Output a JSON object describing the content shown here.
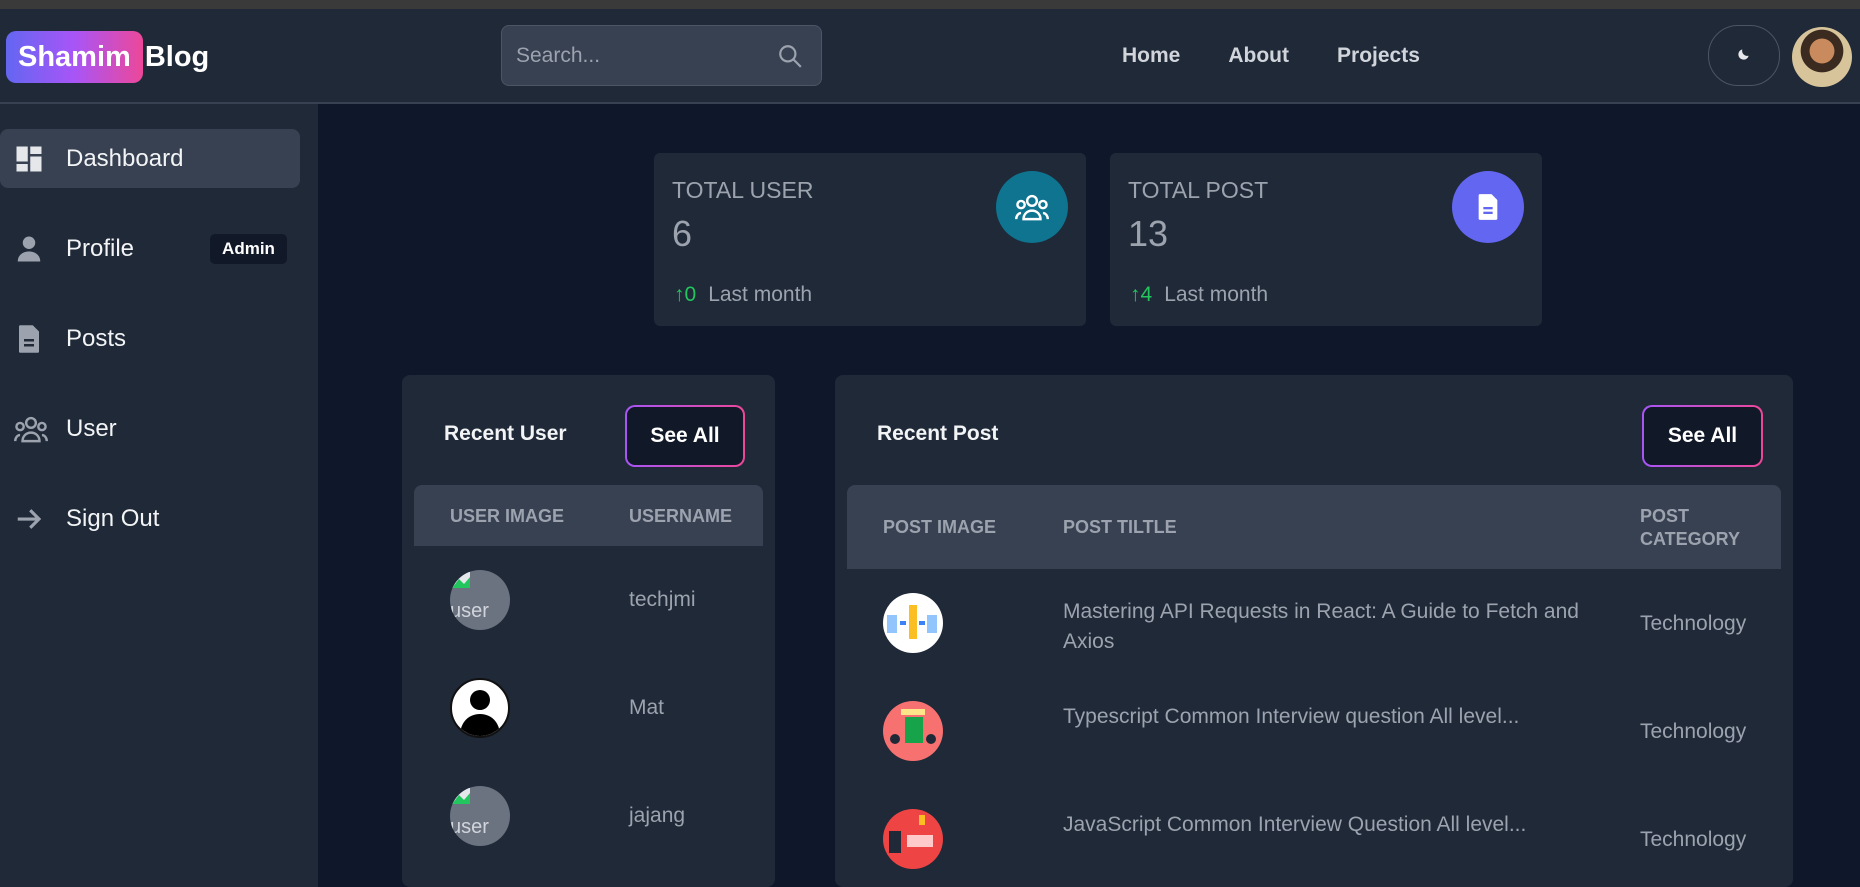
{
  "brand": {
    "pill": "Shamim",
    "text": "Blog"
  },
  "search": {
    "placeholder": "Search..."
  },
  "nav": {
    "home": "Home",
    "about": "About",
    "projects": "Projects"
  },
  "sidebar": {
    "items": [
      {
        "label": "Dashboard",
        "icon": "dashboard-icon",
        "active": true
      },
      {
        "label": "Profile",
        "icon": "user-icon",
        "badge": "Admin"
      },
      {
        "label": "Posts",
        "icon": "document-icon"
      },
      {
        "label": "User",
        "icon": "users-icon"
      },
      {
        "label": "Sign Out",
        "icon": "arrow-right-icon"
      }
    ]
  },
  "stats": {
    "users": {
      "title": "TOTAL USER",
      "value": "6",
      "change": "0",
      "period": "Last month",
      "color": "#0e7490"
    },
    "posts": {
      "title": "TOTAL POST",
      "value": "13",
      "change": "4",
      "period": "Last month",
      "color": "#6366f1"
    }
  },
  "recent_users": {
    "title": "Recent User",
    "see_all": "See All",
    "columns": [
      "USER IMAGE",
      "USERNAME"
    ],
    "rows": [
      {
        "username": "techjmi",
        "image_alt": "user"
      },
      {
        "username": "Mat",
        "image_alt": ""
      },
      {
        "username": "jajang",
        "image_alt": "user"
      }
    ]
  },
  "recent_posts": {
    "title": "Recent Post",
    "see_all": "See All",
    "columns": [
      "POST IMAGE",
      "POST TILTLE",
      "POST CATEGORY"
    ],
    "rows": [
      {
        "title": "Mastering API Requests in React: A Guide to Fetch and Axios",
        "category": "Technology"
      },
      {
        "title": "Typescript Common Interview question All level...",
        "category": "Technology"
      },
      {
        "title": "JavaScript Common Interview Question All level...",
        "category": "Technology"
      }
    ]
  },
  "colors": {
    "bg": "#0f172a",
    "surface": "#1f2937",
    "header": "#374151",
    "accent_gradient": [
      "#6366f1",
      "#a855f7",
      "#ec4899"
    ],
    "positive": "#22c55e"
  }
}
